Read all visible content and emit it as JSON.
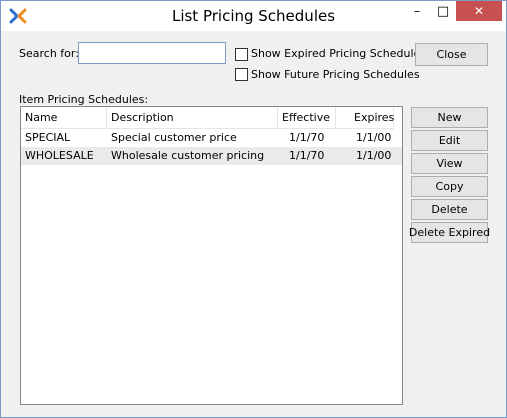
{
  "window": {
    "title": "List Pricing Schedules",
    "minimize_glyph": "–",
    "maximize_glyph": "□",
    "close_glyph": "✕"
  },
  "search": {
    "label": "Search for:",
    "value": "",
    "placeholder": ""
  },
  "options": {
    "show_expired_label": "Show Expired Pricing Schedules",
    "show_future_label": "Show Future Pricing Schedules",
    "show_expired_checked": false,
    "show_future_checked": false
  },
  "table": {
    "section_label": "Item Pricing Schedules:",
    "columns": [
      "Name",
      "Description",
      "Effective",
      "Expires"
    ],
    "rows": [
      {
        "name": "SPECIAL",
        "description": "Special customer price",
        "effective": "1/1/70",
        "expires": "1/1/00"
      },
      {
        "name": "WHOLESALE",
        "description": "Wholesale customer pricing",
        "effective": "1/1/70",
        "expires": "1/1/00"
      }
    ]
  },
  "buttons": {
    "close": "Close",
    "new": "New",
    "edit": "Edit",
    "view": "View",
    "copy": "Copy",
    "delete": "Delete",
    "delete_expired": "Delete Expired"
  },
  "colors": {
    "titlebar_close_bg": "#c75050",
    "window_border": "#7a9ac8",
    "app_icon_blue": "#2a6fcf",
    "app_icon_orange": "#f08a24"
  },
  "icons": {
    "app_icon": "xtuple-x-icon"
  }
}
